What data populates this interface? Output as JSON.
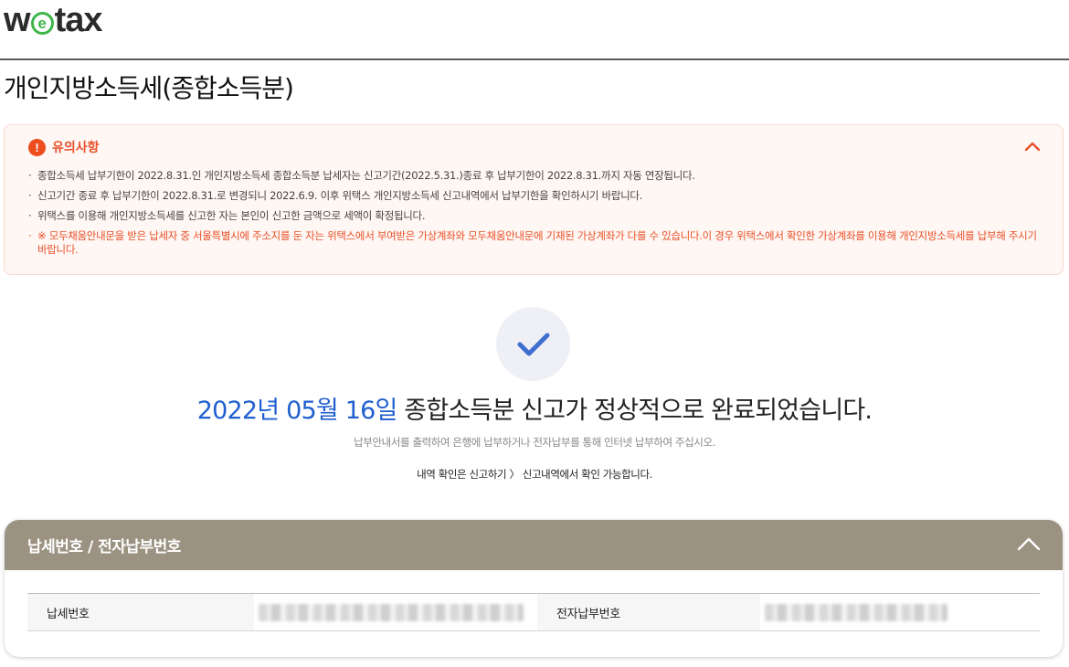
{
  "logo": {
    "prefix": "w",
    "e": "e",
    "suffix": "tax"
  },
  "page_title": "개인지방소득세(종합소득분)",
  "notice": {
    "title": "유의사항",
    "items": [
      "종합소득세 납부기한이 2022.8.31.인 개인지방소득세 종합소득분 납세자는 신고기간(2022.5.31.)종료 후 납부기한이 2022.8.31.까지 자동 연장됩니다.",
      "신고기간 종료 후 납부기한이 2022.8.31.로 변경되니 2022.6.9. 이후 위택스 개인지방소득세 신고내역에서 납부기한을 확인하시기 바랍니다.",
      "위택스를 이용해 개인지방소득세를 신고한 자는 본인이 신고한 금액으로 세액이 확정됩니다.",
      "※ 모두채움안내문을 받은 납세자 중 서울특별시에 주소지를 둔 자는 위택스에서 부여받은 가상계좌와 모두채움안내문에 기재된 가상계좌가 다를 수 있습니다.이 경우 위택스에서 확인한 가상계좌를 이용해 개인지방소득세를 납부해 주시기 바랍니다."
    ]
  },
  "completion": {
    "date": "2022년 05월 16일",
    "message": " 종합소득분 신고가 정상적으로 완료되었습니다.",
    "sub1": "납부안내서를 출력하여 은행에 납부하거나 전자납부를 통해 인터넷 납부하여 주십시오.",
    "sub2": "내역 확인은 신고하기 〉 신고내역에서 확인 가능합니다."
  },
  "panel": {
    "title": "납세번호 / 전자납부번호",
    "tax_number_label": "납세번호",
    "e_payment_label": "전자납부번호"
  },
  "colors": {
    "accent_blue": "#1f5fcf",
    "warning_red": "#e8502a",
    "panel_head": "#9b9282",
    "logo_green": "#3db54a"
  }
}
